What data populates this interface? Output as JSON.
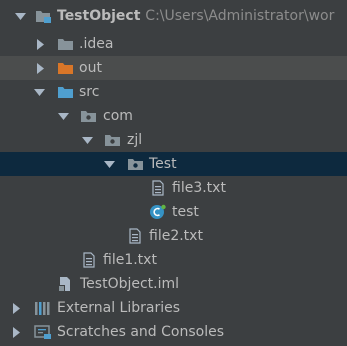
{
  "project": {
    "name": "TestObject",
    "path": "C:\\Users\\Administrator\\wor"
  },
  "nodes": {
    "idea": ".idea",
    "out": "out",
    "src": "src",
    "com": "com",
    "zjl": "zjl",
    "test_pkg": "Test",
    "file3": "file3.txt",
    "test_class": "test",
    "file2": "file2.txt",
    "file1": "file1.txt",
    "iml": "TestObject.iml",
    "ext_libs": "External Libraries",
    "scratches": "Scratches and Consoles"
  },
  "colors": {
    "background": "#3c3f41",
    "selected_row": "#0d293e",
    "hover_row": "#4b4d4d",
    "folder": "#87939a",
    "excluded_folder": "#d97628",
    "source_folder": "#4f9fcf",
    "class_icon": "#3592c4"
  },
  "icons": {
    "project": "module-folder-icon",
    "folder": "folder-icon",
    "package": "package-icon",
    "text_file": "text-file-icon",
    "class": "class-icon",
    "iml": "iml-file-icon",
    "libraries": "libraries-icon",
    "scratches": "scratches-icon"
  }
}
